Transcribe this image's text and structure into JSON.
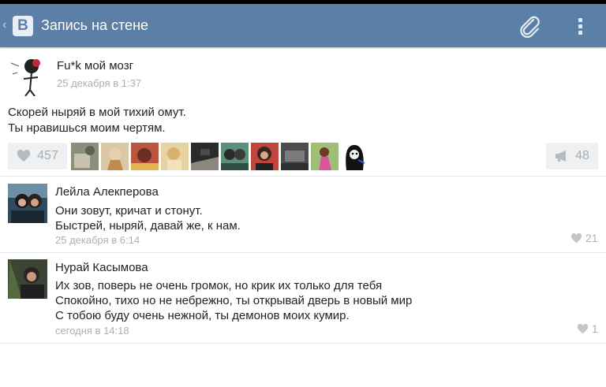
{
  "header": {
    "title": "Запись на стене",
    "logo_letter": "В",
    "bg_color": "#5b7fa6"
  },
  "post": {
    "author": "Fu*k мой мозг",
    "time": "25 декабря в 1:37",
    "text_lines": [
      "Скорей ныряй в мой тихий омут.",
      "Ты нравишься моим чертям."
    ],
    "likes": "457",
    "reposts": "48",
    "liker_count_shown": 10
  },
  "comments": [
    {
      "name": "Лейла Алекперова",
      "lines": [
        "Они зовут, кричат и стонут.",
        "Быстрей, ныряй, давай же, к нам."
      ],
      "time": "25 декабря в 6:14",
      "likes": "21"
    },
    {
      "name": "Нурай Касымова",
      "lines": [
        "Их зов, поверь не очень громок, но крик их только для тебя",
        "Спокойно, тихо но не небрежно, ты открывай дверь в новый мир",
        "С тобою буду очень нежной, ты демонов моих кумир."
      ],
      "time": "сегодня в 14:18",
      "likes": "1"
    }
  ],
  "icons": {
    "back": "back-arrow-icon",
    "attach": "paperclip-icon",
    "menu": "overflow-menu-icon",
    "like": "heart-icon",
    "repost": "megaphone-icon"
  }
}
